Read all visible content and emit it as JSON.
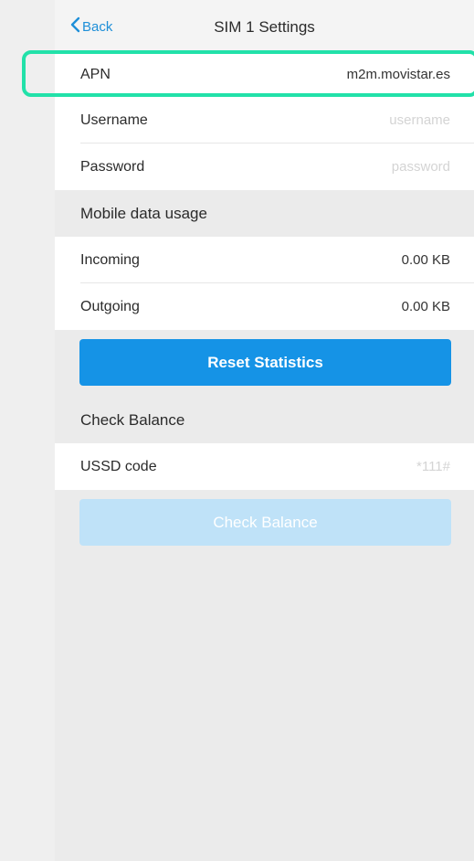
{
  "nav": {
    "back_label": "Back",
    "title": "SIM 1 Settings"
  },
  "apn": {
    "label": "APN",
    "value": "m2m.movistar.es"
  },
  "username": {
    "label": "Username",
    "placeholder": "username",
    "value": ""
  },
  "password": {
    "label": "Password",
    "placeholder": "password",
    "value": ""
  },
  "usage": {
    "section_title": "Mobile data usage",
    "incoming_label": "Incoming",
    "incoming_value": "0.00 KB",
    "outgoing_label": "Outgoing",
    "outgoing_value": "0.00 KB",
    "reset_label": "Reset Statistics"
  },
  "balance": {
    "section_title": "Check Balance",
    "ussd_label": "USSD code",
    "ussd_placeholder": "*111#",
    "check_label": "Check Balance"
  },
  "colors": {
    "accent": "#1593e6",
    "disabled_button": "#bfe2f8",
    "highlight": "#22e1a9",
    "link": "#1e8fd8"
  },
  "icons": {
    "back": "chevron-left-icon"
  }
}
